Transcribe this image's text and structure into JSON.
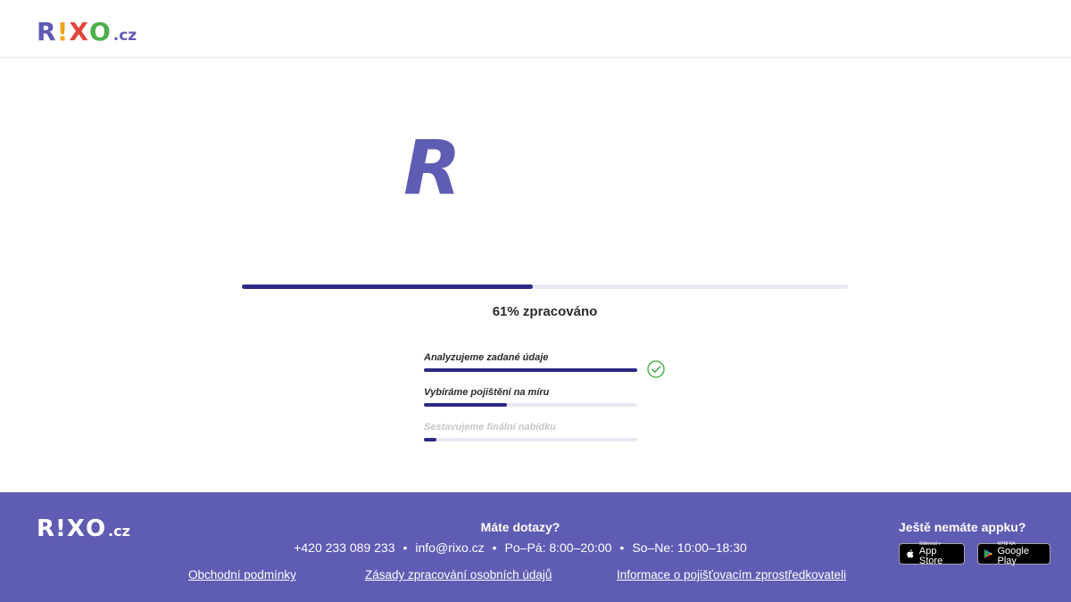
{
  "header": {
    "logo": {
      "r": "R",
      "i": "!",
      "x": "X",
      "o": "O",
      "tld": ".cz"
    }
  },
  "hero": {
    "letter": "R"
  },
  "progress": {
    "percent": 61,
    "text": "61% zpracováno"
  },
  "steps": [
    {
      "label": "Analyzujeme zadané údaje",
      "progress": 1.0,
      "done": true
    },
    {
      "label": "Vybíráme pojištění na míru",
      "progress": 0.39,
      "done": false
    },
    {
      "label": "Sestavujeme finální nabídku",
      "progress": 0.06,
      "done": false
    }
  ],
  "footer": {
    "logo": {
      "r": "R",
      "i": "!",
      "x": "X",
      "o": "O",
      "tld": ".cz"
    },
    "contact_title": "Máte dotazy?",
    "phone": "+420 233 089 233",
    "email": "info@rixo.cz",
    "hours_weekday": "Po–Pá: 8:00–20:00",
    "hours_weekend": "So–Ne: 10:00–18:30",
    "separator": "•",
    "links": [
      "Obchodní podmínky",
      "Zásady zpracování osobních údajů",
      "Informace o pojišťovacím zprostředkovateli"
    ],
    "app_title": "Ještě nemáte appku?",
    "app_store": {
      "small": "Stáhnout v",
      "big": "App Store",
      "icon": "apple-icon"
    },
    "google_play": {
      "small": "NYNÍ NA",
      "big": "Google Play",
      "icon": "google-play-icon"
    }
  },
  "colors": {
    "brand_purple": "#5f5cb3",
    "progress_dark": "#2d2a86",
    "track": "#e9e8f4",
    "check_green": "#4cae4c",
    "logo_red": "#e0453d",
    "logo_orange": "#f2a21b"
  }
}
